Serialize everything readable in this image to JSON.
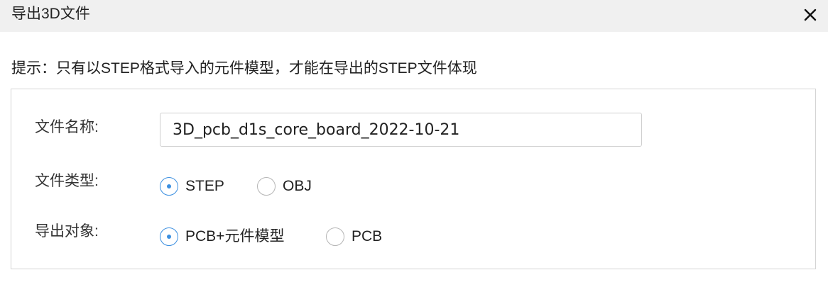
{
  "dialog": {
    "title": "导出3D文件",
    "close_icon": "close-icon"
  },
  "hint": "提示：只有以STEP格式导入的元件模型，才能在导出的STEP文件体现",
  "form": {
    "filename": {
      "label": "文件名称:",
      "value": "3D_pcb_d1s_core_board_2022-10-21"
    },
    "filetype": {
      "label": "文件类型:",
      "options": [
        {
          "label": "STEP",
          "checked": true
        },
        {
          "label": "OBJ",
          "checked": false
        }
      ]
    },
    "export_target": {
      "label": "导出对象:",
      "options": [
        {
          "label": "PCB+元件模型",
          "checked": true
        },
        {
          "label": "PCB",
          "checked": false
        }
      ]
    }
  },
  "colors": {
    "accent": "#3b8fe0",
    "titlebar_bg": "#f0f0f0",
    "border": "#d4d4d4"
  }
}
